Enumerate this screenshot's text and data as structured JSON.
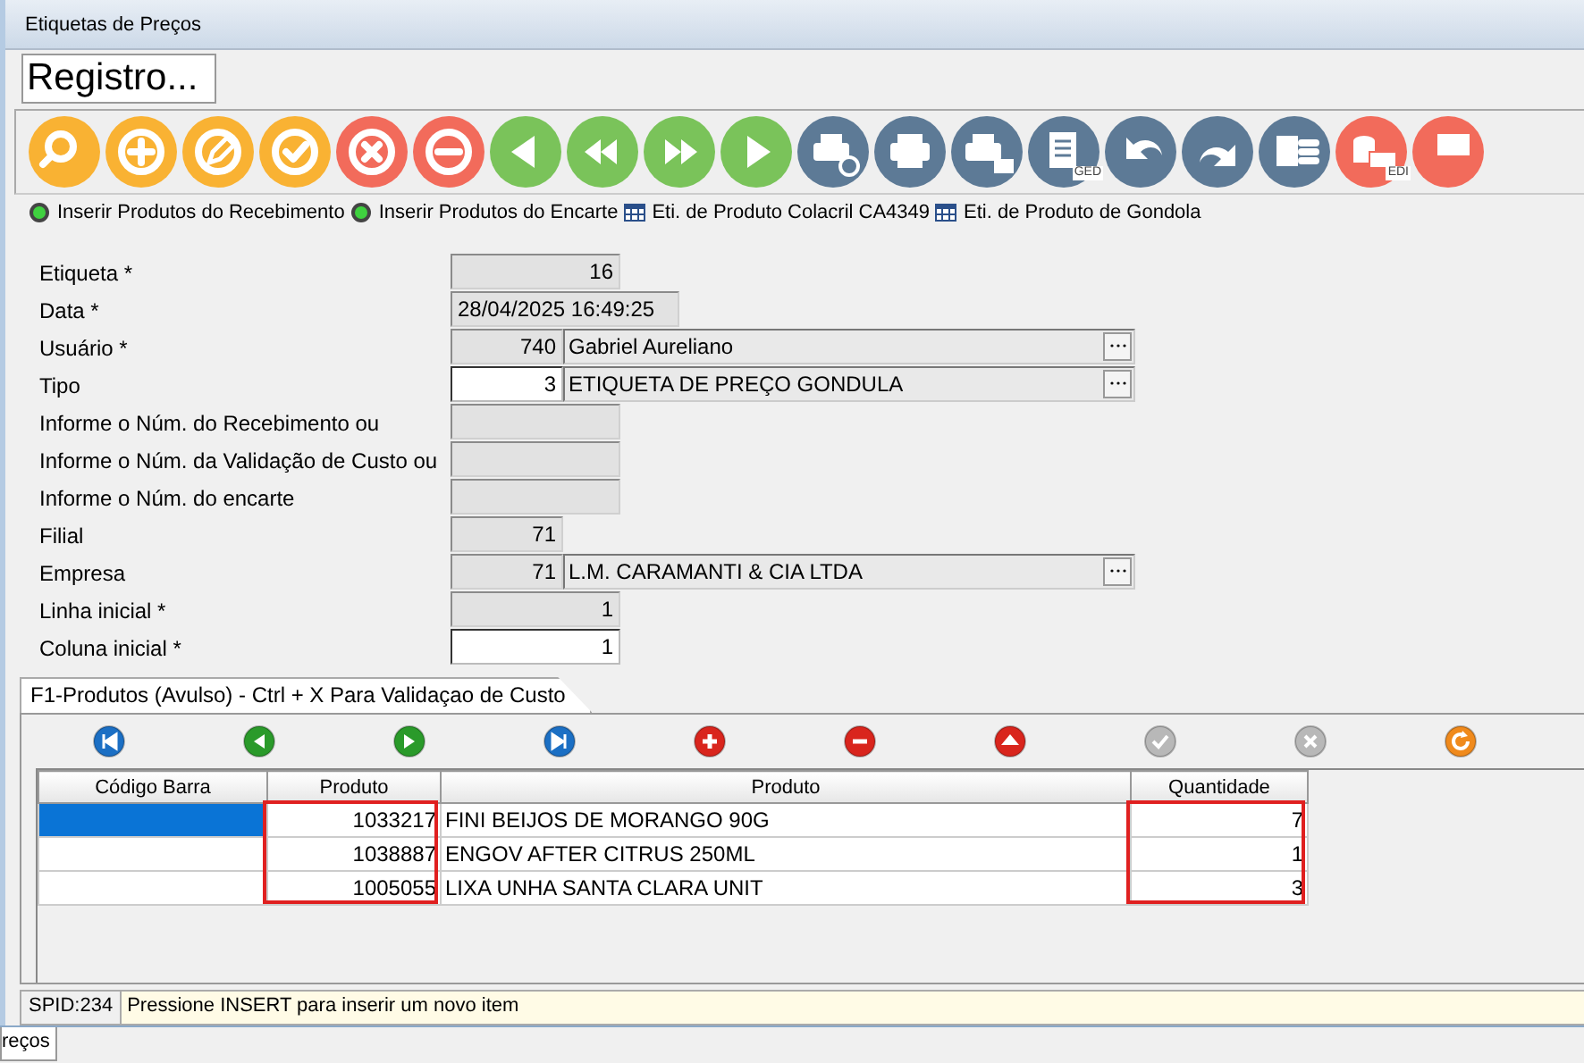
{
  "window": {
    "title": "Etiquetas de Preços"
  },
  "header": {
    "text": "Registro..."
  },
  "toolbar": [
    {
      "kind": "search"
    },
    {
      "kind": "add"
    },
    {
      "kind": "edit"
    },
    {
      "kind": "confirm"
    },
    {
      "kind": "cancel"
    },
    {
      "kind": "remove"
    },
    {
      "kind": "prev"
    },
    {
      "kind": "first"
    },
    {
      "kind": "last"
    },
    {
      "kind": "next"
    },
    {
      "kind": "print-preview"
    },
    {
      "kind": "print"
    },
    {
      "kind": "print-mail"
    },
    {
      "kind": "doc",
      "label": "GED"
    },
    {
      "kind": "undo"
    },
    {
      "kind": "redo"
    },
    {
      "kind": "export"
    },
    {
      "kind": "database",
      "label": "EDI"
    },
    {
      "kind": "edi-cut"
    }
  ],
  "actions": [
    {
      "kind": "led",
      "label": "Inserir Produtos do Recebimento"
    },
    {
      "kind": "led",
      "label": "Inserir Produtos do Encarte"
    },
    {
      "kind": "grid",
      "label": "Eti. de Produto Colacril CA4349"
    },
    {
      "kind": "grid",
      "label": "Eti. de Produto de Gondola"
    }
  ],
  "form": [
    {
      "label": "Etiqueta *",
      "kind": "number",
      "value": "16",
      "readonly": true
    },
    {
      "label": "Data *",
      "kind": "text",
      "value": "28/04/2025 16:49:25",
      "readonly": true
    },
    {
      "label": "Usuário *",
      "kind": "lookup",
      "value": "740",
      "name": "Gabriel Aureliano",
      "readonly": true
    },
    {
      "label": "Tipo",
      "kind": "lookup",
      "value": "3",
      "name": "ETIQUETA DE PREÇO GONDULA",
      "readonly": false
    },
    {
      "label": "Informe o Núm. do Recebimento ou",
      "kind": "number",
      "readonly": true
    },
    {
      "label": "Informe o Núm. da Validação de Custo ou",
      "kind": "number",
      "readonly": true
    },
    {
      "label": "Informe o Núm. do encarte",
      "kind": "number",
      "readonly": true
    },
    {
      "label": "Filial",
      "kind": "code",
      "value": "71",
      "readonly": true
    },
    {
      "label": "Empresa",
      "kind": "lookup",
      "value": "71",
      "name": "L.M. CARAMANTI & CIA LTDA",
      "readonly": true
    },
    {
      "label": "Linha inicial *",
      "kind": "number",
      "value": "1",
      "readonly": true
    },
    {
      "label": "Coluna inicial *",
      "kind": "number",
      "value": "1",
      "readonly": false
    }
  ],
  "tab": {
    "label": "F1-Produtos (Avulso) - Ctrl + X Para Validaçao de Custo",
    "selected": true
  },
  "grid_toolbar": [
    {
      "kind": "first",
      "disabled": false
    },
    {
      "kind": "prev",
      "disabled": false
    },
    {
      "kind": "next",
      "disabled": false
    },
    {
      "kind": "last",
      "disabled": false
    },
    {
      "kind": "add",
      "disabled": false
    },
    {
      "kind": "remove",
      "disabled": false
    },
    {
      "kind": "up",
      "disabled": false
    },
    {
      "kind": "confirm",
      "disabled": true
    },
    {
      "kind": "cancel",
      "disabled": true
    },
    {
      "kind": "refresh",
      "disabled": false
    }
  ],
  "table": {
    "columns": [
      {
        "label": "Código Barra",
        "highlighted": false
      },
      {
        "label": "Produto",
        "highlighted": true
      },
      {
        "label": "Produto",
        "highlighted": false
      },
      {
        "label": "Quantidade",
        "highlighted": true
      }
    ],
    "rows": [
      {
        "selected": true,
        "cells": [
          "",
          "1033217",
          "FINI BEIJOS DE MORANGO 90G",
          "7"
        ]
      },
      {
        "selected": false,
        "cells": [
          "",
          "1038887",
          "ENGOV AFTER CITRUS 250ML",
          "1"
        ]
      },
      {
        "selected": false,
        "cells": [
          "",
          "1005055",
          "LIXA UNHA SANTA CLARA UNIT",
          "3"
        ]
      }
    ]
  },
  "status_bar": {
    "spid": "SPID:234",
    "message": "Pressione INSERT para inserir um novo item"
  },
  "taskbar": [
    {
      "label": "reços",
      "selected": true
    }
  ]
}
